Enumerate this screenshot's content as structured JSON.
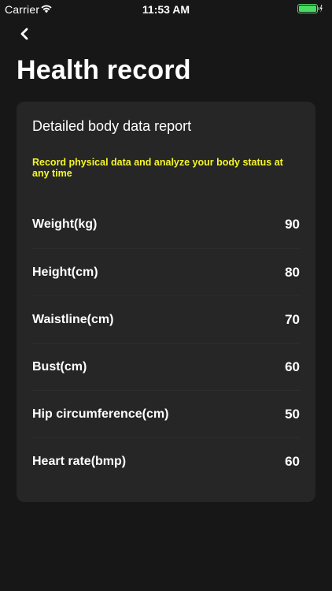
{
  "status_bar": {
    "carrier": "Carrier",
    "time": "11:53 AM"
  },
  "header": {
    "title": "Health record"
  },
  "report": {
    "title": "Detailed body data report",
    "subtitle": "Record physical data and analyze your body status at any time",
    "accent_color": "#f5f52a",
    "rows": [
      {
        "label": "Weight(kg)",
        "value": "90"
      },
      {
        "label": "Height(cm)",
        "value": "80"
      },
      {
        "label": "Waistline(cm)",
        "value": "70"
      },
      {
        "label": "Bust(cm)",
        "value": "60"
      },
      {
        "label": "Hip circumference(cm)",
        "value": "50"
      },
      {
        "label": "Heart rate(bmp)",
        "value": "60"
      }
    ]
  },
  "icons": {
    "back": "chevron-left-icon",
    "wifi": "wifi-icon",
    "battery": "battery-icon"
  },
  "colors": {
    "background": "#171717",
    "card": "#262626",
    "battery_fill": "#4cd964"
  }
}
